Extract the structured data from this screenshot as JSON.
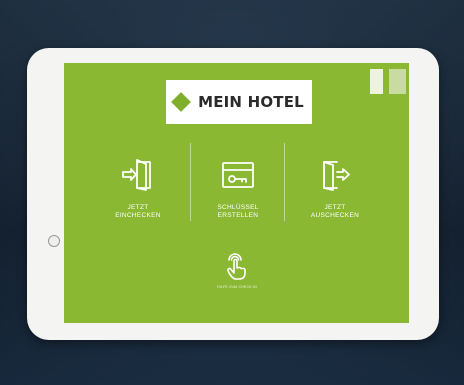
{
  "app": {
    "logo_text": "MEIN HOTEL",
    "accent_color": "#8ab832"
  },
  "language": {
    "options": [
      "",
      ""
    ]
  },
  "actions": [
    {
      "label": "JETZT\nEINCHECKEN",
      "icon": "door-enter-icon"
    },
    {
      "label": "SCHLÜSSEL\nERSTELLEN",
      "icon": "keycard-icon"
    },
    {
      "label": "JETZT\nAUSCHECKEN",
      "icon": "door-exit-icon"
    }
  ],
  "help": {
    "label": "HILFE ZUM CHECK-IN",
    "icon": "touch-hand-icon"
  }
}
